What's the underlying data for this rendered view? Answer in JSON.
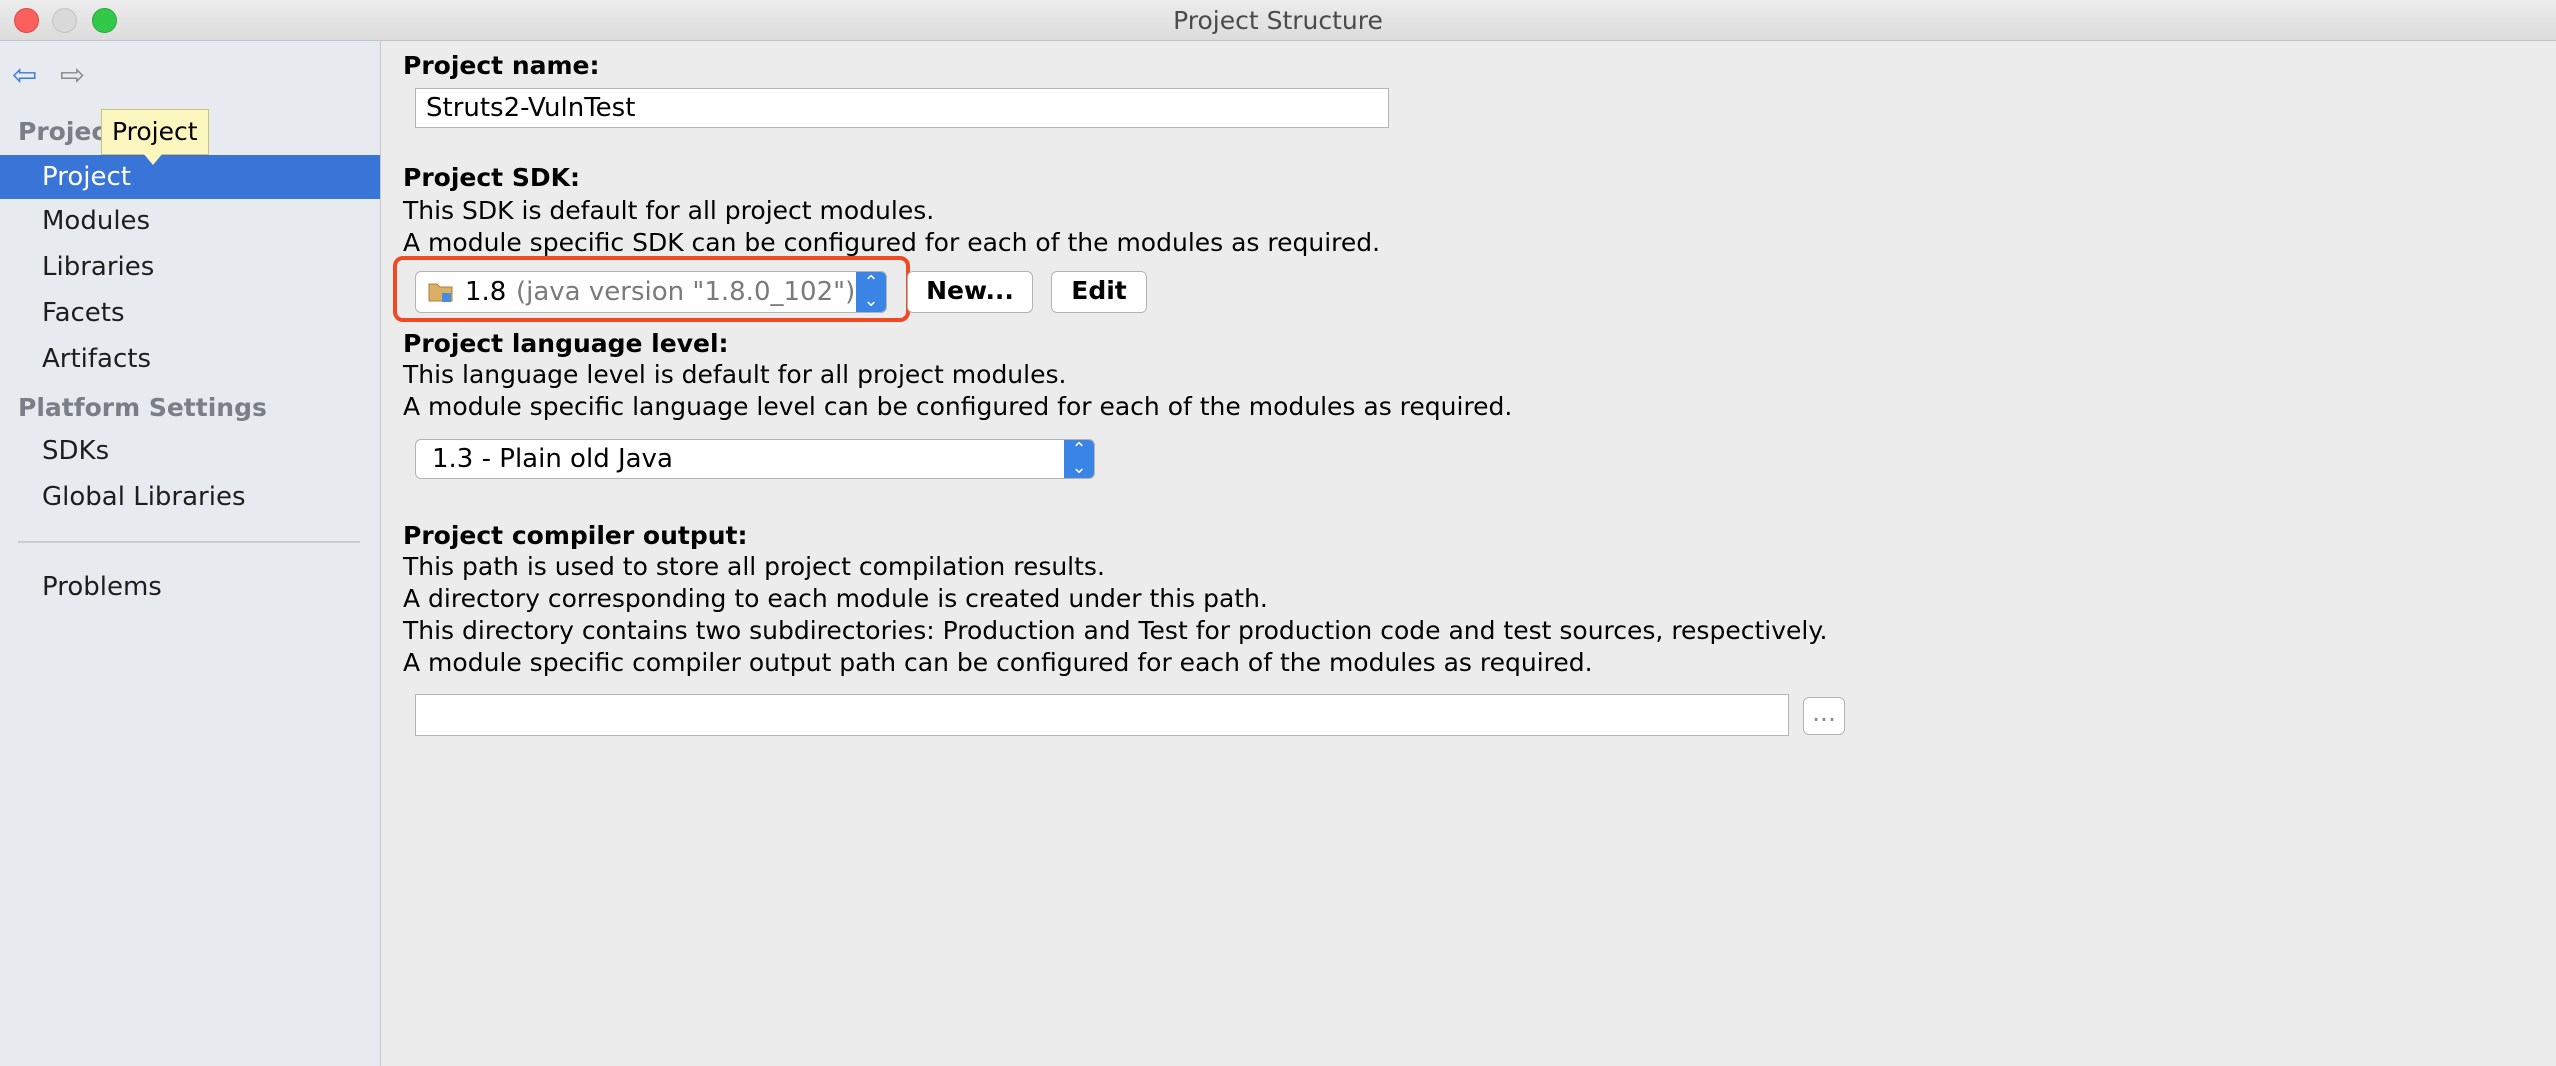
{
  "window": {
    "title": "Project Structure"
  },
  "sidebar": {
    "tooltip": "Project",
    "group_project": "Project Settings",
    "group_project_visible": "Projec         s",
    "items_project": [
      {
        "label": "Project",
        "selected": true
      },
      {
        "label": "Modules"
      },
      {
        "label": "Libraries"
      },
      {
        "label": "Facets"
      },
      {
        "label": "Artifacts"
      }
    ],
    "group_platform": "Platform Settings",
    "items_platform": [
      {
        "label": "SDKs"
      },
      {
        "label": "Global Libraries"
      }
    ],
    "problems": "Problems",
    "back_icon": "arrow-left-icon",
    "forward_icon": "arrow-right-icon"
  },
  "main": {
    "project_name": {
      "label": "Project name:",
      "value": "Struts2-VulnTest"
    },
    "sdk": {
      "label": "Project SDK:",
      "desc1": "This SDK is default for all project modules.",
      "desc2": "A module specific SDK can be configured for each of the modules as required.",
      "selected_version": "1.8",
      "selected_detail": "(java version \"1.8.0_102\")",
      "new_button": "New...",
      "edit_button": "Edit",
      "highlight_color": "#ef4a23"
    },
    "language_level": {
      "label": "Project language level:",
      "desc1": "This language level is default for all project modules.",
      "desc2": "A module specific language level can be configured for each of the modules as required.",
      "selected": "1.3 - Plain old Java"
    },
    "compiler_output": {
      "label": "Project compiler output:",
      "desc1": "This path is used to store all project compilation results.",
      "desc2": "A directory corresponding to each module is created under this path.",
      "desc3": "This directory contains two subdirectories: Production and Test for production code and test sources, respectively.",
      "desc4": "A module specific compiler output path can be configured for each of the modules as required.",
      "value": "",
      "browse_button": "..."
    }
  },
  "colors": {
    "selection": "#3875d7",
    "accent": "#3a84e6"
  }
}
